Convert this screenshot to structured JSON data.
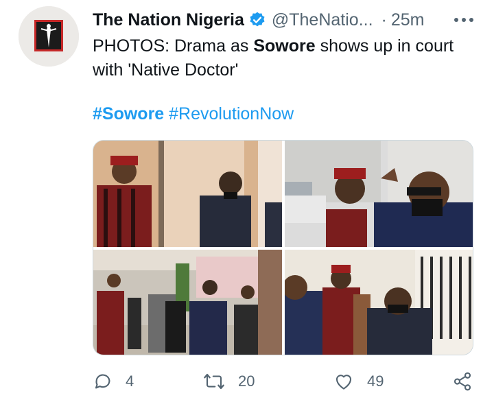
{
  "tweet": {
    "display_name": "The Nation Nigeria",
    "handle": "@TheNatio...",
    "separator": "·",
    "time": "25m",
    "text_prefix": "PHOTOS: Drama as ",
    "text_bold": "Sowore",
    "text_suffix": " shows up in court with 'Native Doctor'",
    "hashtags": [
      "#Sowore",
      "#RevolutionNow"
    ]
  },
  "media": {
    "photos": [
      {
        "description": "photo-1"
      },
      {
        "description": "photo-2"
      },
      {
        "description": "photo-3"
      },
      {
        "description": "photo-4"
      }
    ]
  },
  "actions": {
    "replies": "4",
    "retweets": "20",
    "likes": "49"
  },
  "colors": {
    "accent": "#1d9bf0",
    "secondary_text": "#536471",
    "verified": "#1d9bf0",
    "avatar_red": "#c62828"
  },
  "icons": {
    "verified": "verified-badge-icon",
    "more": "more-dots-icon",
    "reply": "reply-icon",
    "retweet": "retweet-icon",
    "like": "heart-icon",
    "share": "share-icon"
  }
}
